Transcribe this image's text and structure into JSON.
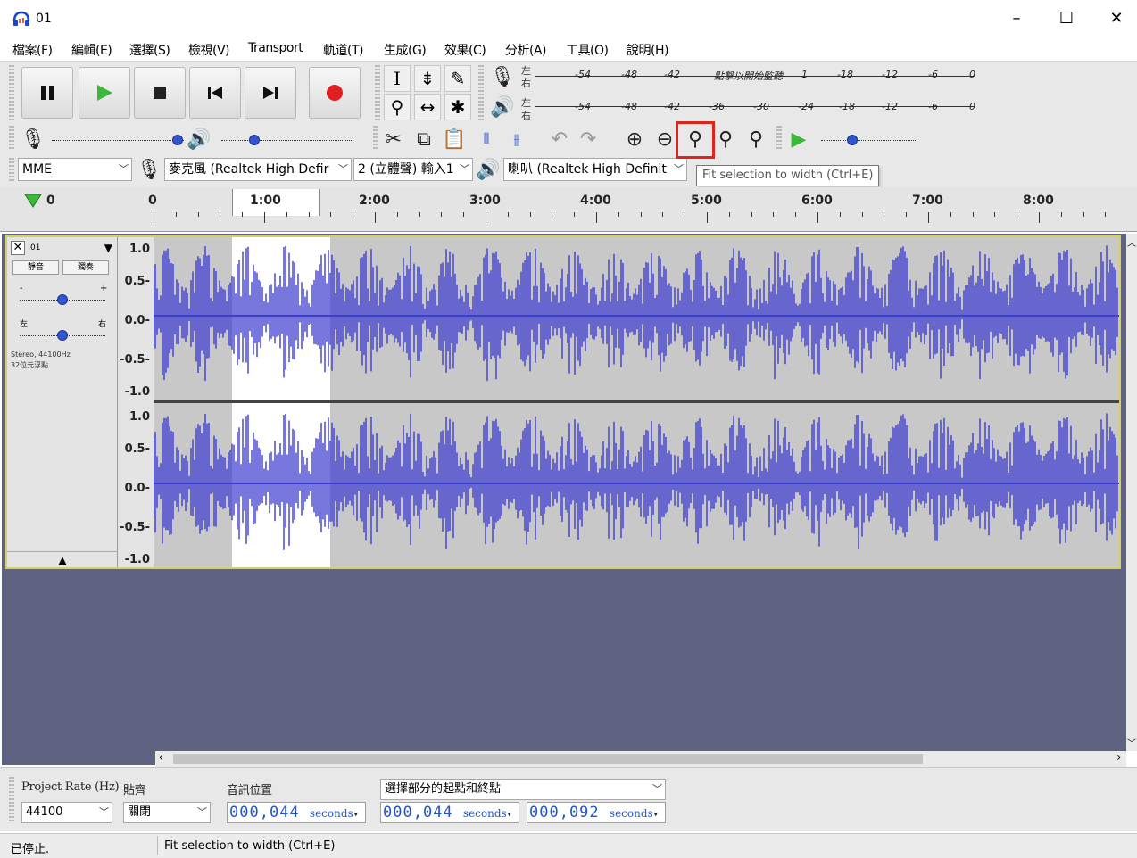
{
  "window": {
    "title": "01",
    "min_label": "–",
    "max_label": "☐",
    "close_label": "✕"
  },
  "menu": [
    "檔案(F)",
    "編輯(E)",
    "選擇(S)",
    "檢視(V)",
    "Transport",
    "軌道(T)",
    "生成(G)",
    "效果(C)",
    "分析(A)",
    "工具(O)",
    "說明(H)"
  ],
  "meters": {
    "record_side_top": "左",
    "record_side_bottom": "右",
    "play_side_top": "左",
    "play_side_bottom": "右",
    "record_ticks": [
      "-54",
      "-48",
      "-42",
      "點擊以開始監聽",
      "1",
      "-18",
      "-12",
      "-6",
      "0"
    ],
    "play_ticks": [
      "-54",
      "-48",
      "-42",
      "-36",
      "-30",
      "-24",
      "-18",
      "-12",
      "-6",
      "0"
    ]
  },
  "mixer": {
    "record_volume": 0.95,
    "play_volume": 0.25,
    "play_speed": 0.32
  },
  "devices": {
    "host": "MME",
    "input": "麥克風 (Realtek High Defir",
    "channels": "2 (立體聲) 輸入1",
    "output": "喇叭 (Realtek High Definit"
  },
  "tooltip": "Fit selection to width (Ctrl+E)",
  "ruler": {
    "start_label": "0",
    "labels": [
      "0",
      "1:00",
      "2:00",
      "3:00",
      "4:00",
      "5:00",
      "6:00",
      "7:00",
      "8:00"
    ]
  },
  "track": {
    "name": "01",
    "mute": "靜音",
    "solo": "獨奏",
    "pan_left": "左",
    "pan_right": "右",
    "gain_minus": "-",
    "gain_plus": "+",
    "info_line1": "Stereo, 44100Hz",
    "info_line2": "32位元浮點",
    "gain_level": 0.5,
    "pan_level": 0.5,
    "scale_top": [
      "1.0",
      "0.5-",
      "0.0-",
      "-0.5-",
      "-1.0"
    ],
    "scale_bottom": [
      "1.0",
      "0.5-",
      "0.0-",
      "-0.5-",
      "-1.0"
    ]
  },
  "selection_bar": {
    "rate_label": "Project Rate (Hz)",
    "rate_value": "44100",
    "snap_label": "貼齊",
    "snap_value": "關閉",
    "audio_pos_label": "音訊位置",
    "audio_pos_value": "000,044",
    "unit": "seconds",
    "sel_mode": "選擇部分的起點和終點",
    "sel_start": "000,044",
    "sel_end": "000,092"
  },
  "status": {
    "state": "已停止.",
    "message": "Fit selection to width (Ctrl+E)"
  },
  "colors": {
    "waveform": "#3d3dd0",
    "selection": "#ffffff",
    "track_border": "#d6cf63",
    "empty_area": "#5f6281",
    "highlight": "#e0241a"
  }
}
